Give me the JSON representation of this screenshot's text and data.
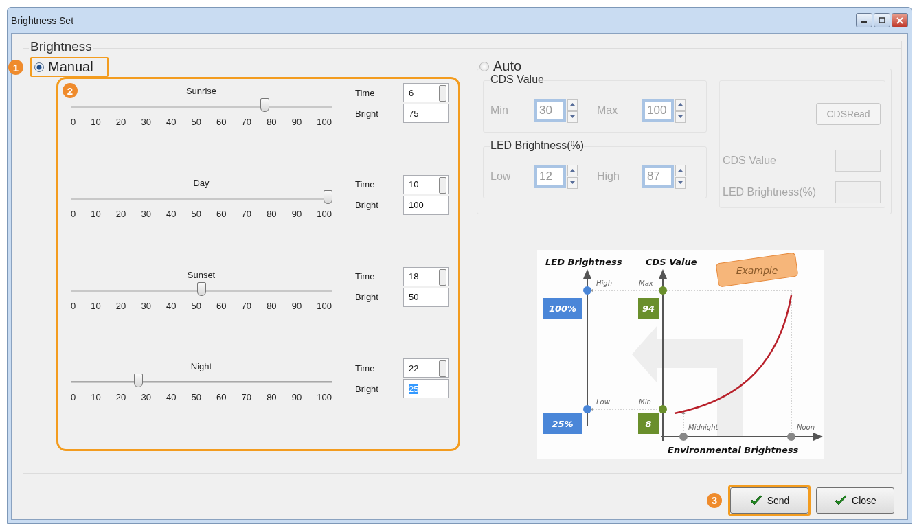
{
  "window": {
    "title": "Brightness Set"
  },
  "group": {
    "title": "Brightness"
  },
  "manual": {
    "label": "Manual",
    "selected": true,
    "callout": "1"
  },
  "schedule": {
    "callout": "2",
    "slots": [
      {
        "time_label": "Time",
        "bright_label": "Bright",
        "name": "Sunrise",
        "level": 0.75,
        "time": "6",
        "bright": "75",
        "highlighted": false,
        "ticks": [
          "0",
          "10",
          "20",
          "30",
          "40",
          "50",
          "60",
          "70",
          "80",
          "90",
          "100"
        ]
      },
      {
        "time_label": "Time",
        "bright_label": "Bright",
        "name": "Day",
        "level": 1.0,
        "time": "10",
        "bright": "100",
        "highlighted": false,
        "ticks": [
          "0",
          "10",
          "20",
          "30",
          "40",
          "50",
          "60",
          "70",
          "80",
          "90",
          "100"
        ]
      },
      {
        "time_label": "Time",
        "bright_label": "Bright",
        "name": "Sunset",
        "level": 0.5,
        "time": "18",
        "bright": "50",
        "highlighted": false,
        "ticks": [
          "0",
          "10",
          "20",
          "30",
          "40",
          "50",
          "60",
          "70",
          "80",
          "90",
          "100"
        ]
      },
      {
        "time_label": "Time",
        "bright_label": "Bright",
        "name": "Night",
        "level": 0.25,
        "time": "22",
        "bright": "25",
        "highlighted": true,
        "ticks": [
          "0",
          "10",
          "20",
          "30",
          "40",
          "50",
          "60",
          "70",
          "80",
          "90",
          "100"
        ]
      }
    ]
  },
  "auto": {
    "label": "Auto",
    "selected": false,
    "disabled": true,
    "cds_group": {
      "title": "CDS Value",
      "min_label": "Min",
      "min": "30",
      "max_label": "Max",
      "max": "100"
    },
    "led_group": {
      "title": "LED Brightness(%)",
      "low_label": "Low",
      "low": "12",
      "high_label": "High",
      "high": "87"
    },
    "read_button": "CDSRead",
    "cds_value_label": "CDS Value",
    "led_value_label": "LED Brightness(%)"
  },
  "diagram": {
    "left_axis": "LED Brightness",
    "right_axis": "CDS Value",
    "badge": "Example",
    "high_label": "High",
    "max_label": "Max",
    "high_value": "100%",
    "max_value": "94",
    "low_label": "Low",
    "min_label": "Min",
    "low_value": "25%",
    "min_value": "8",
    "start_label": "Midnight",
    "end_label": "Noon",
    "x_axis": "Environmental Brightness"
  },
  "buttons": [
    {
      "label": "Send",
      "callout": "3"
    },
    {
      "label": "Close"
    }
  ]
}
